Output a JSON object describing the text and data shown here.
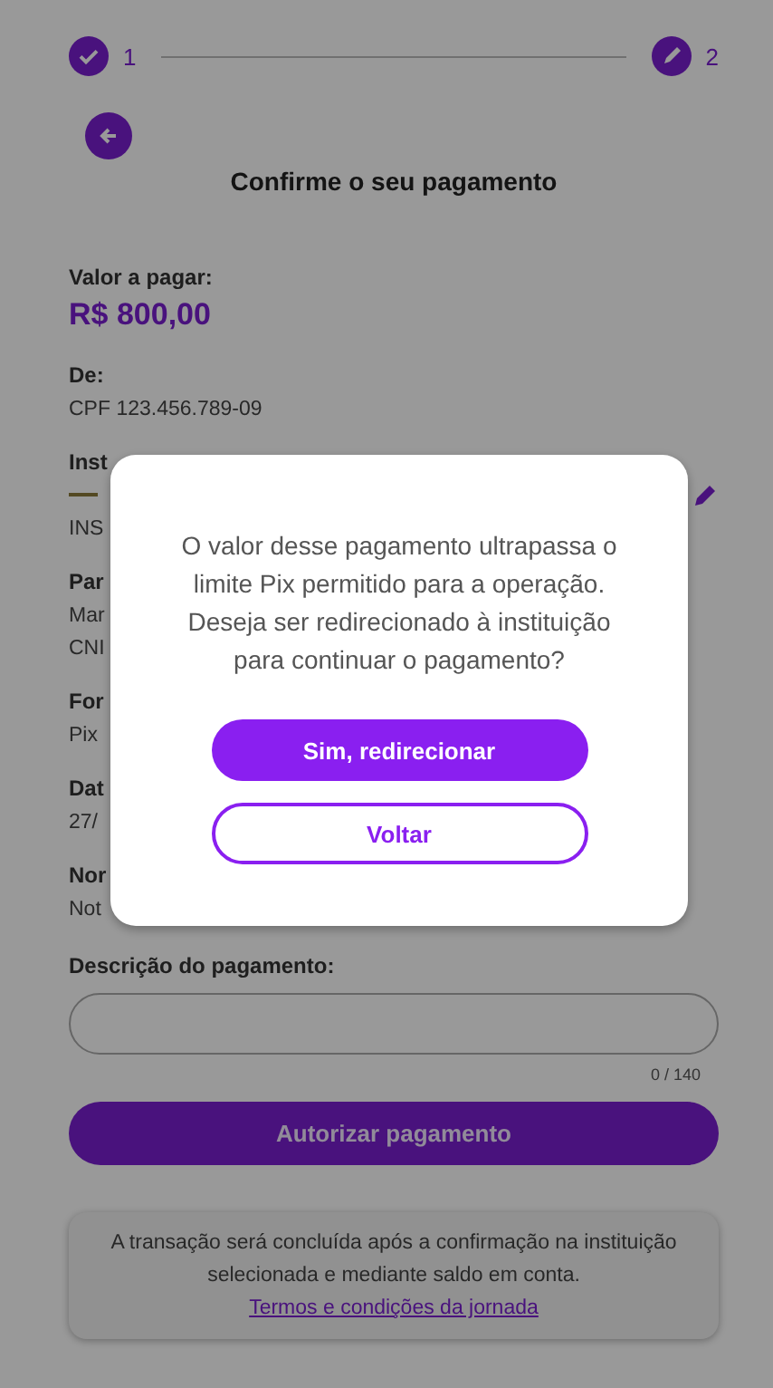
{
  "stepper": {
    "steps": [
      {
        "number": "1",
        "kind": "done"
      },
      {
        "number": "2",
        "kind": "current"
      }
    ]
  },
  "title": "Confirme o seu pagamento",
  "amount": {
    "label": "Valor a pagar:",
    "value": "R$ 800,00"
  },
  "details": [
    {
      "kind": "plain",
      "label": "De:",
      "lines": [
        "CPF 123.456.789-09"
      ]
    },
    {
      "kind": "institution",
      "label": "Inst",
      "lines": [
        "INS"
      ]
    },
    {
      "kind": "plain",
      "label": "Par",
      "lines": [
        "Mar",
        "CNI"
      ]
    },
    {
      "kind": "plain",
      "label": "For",
      "lines": [
        "Pix"
      ]
    },
    {
      "kind": "plain",
      "label": "Dat",
      "lines": [
        "27/"
      ]
    },
    {
      "kind": "plain",
      "label": "Nor",
      "lines": [
        "Not"
      ]
    }
  ],
  "description": {
    "label": "Descrição do pagamento:",
    "counter": "0 / 140"
  },
  "authorize_button": "Autorizar pagamento",
  "notice": {
    "text": "A transação será concluída após a confirmação na instituição selecionada e mediante saldo em conta.",
    "link": "Termos e condições da jornada"
  },
  "dialog": {
    "open": true,
    "message": "O valor desse pagamento ultrapassa o limite Pix permitido para a operação. Deseja ser redirecionado à instituição para continuar o pagamento?",
    "buttons": [
      {
        "label": "Sim, redirecionar",
        "kind": "primary"
      },
      {
        "label": "Voltar",
        "kind": "secondary"
      }
    ]
  }
}
